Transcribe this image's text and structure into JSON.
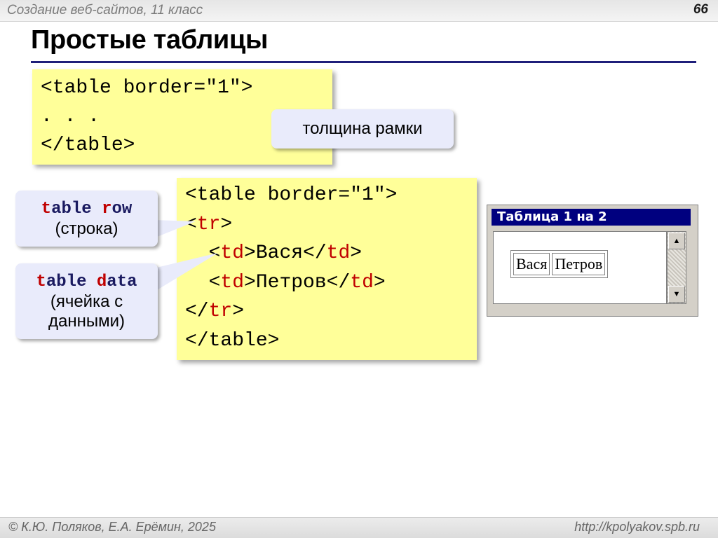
{
  "header": {
    "subtitle": "Создание веб-сайтов, 11 класс",
    "page_number": "66"
  },
  "title": "Простые таблицы",
  "code_block_1": {
    "line1": "<table border=\"1\">",
    "line2": ". . .",
    "line3": "</table>"
  },
  "callouts": {
    "thickness": "толщина рамки",
    "row": {
      "t": "t",
      "able": "able ",
      "r": "r",
      "ow": "ow",
      "translation": "(строка)"
    },
    "data": {
      "t": "t",
      "able": "able ",
      "d": "d",
      "ata": "ata",
      "line2": "(ячейка с",
      "line3": "данными)"
    }
  },
  "code_block_2": {
    "line1": "<table border=\"1\">",
    "tr_open": "<",
    "tr_name": "tr",
    "tr_close": ">",
    "td1_lt": "  <",
    "td1_name": "td",
    "td1_gt": ">Вася</",
    "td1_name_end": "td",
    "td1_end": ">",
    "td2_lt": "  <",
    "td2_name": "td",
    "td2_gt": ">Петров</",
    "td2_name_end": "td",
    "td2_end": ">",
    "tr_end_lt": "</",
    "tr_end_name": "tr",
    "tr_end_gt": ">",
    "line6": "</table>"
  },
  "browser": {
    "title": "Таблица 1 на 2",
    "cells": [
      "Вася",
      "Петров"
    ],
    "scroll_up_icon": "triangle-up",
    "scroll_down_icon": "triangle-down"
  },
  "footer": {
    "left": "© К.Ю. Поляков, Е.А. Ерёмин, 2025",
    "right": "http://kpolyakov.spb.ru"
  },
  "colors": {
    "code_bg": "#ffff99",
    "callout_bg": "#e9ebfb",
    "keyword_red": "#c00000",
    "title_rule": "#1f1f7a",
    "browser_title_bg": "#00007f"
  }
}
